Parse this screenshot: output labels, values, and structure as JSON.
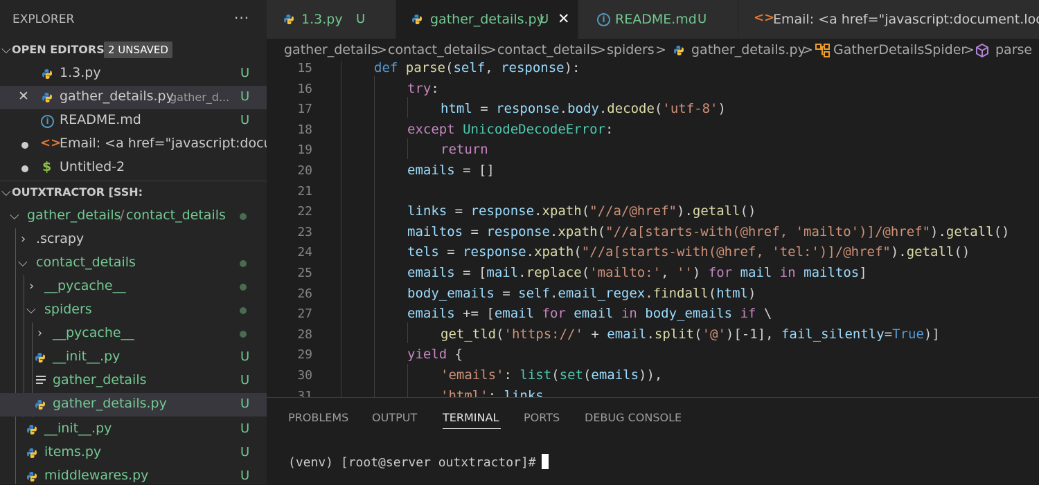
{
  "explorer": {
    "title": "EXPLORER",
    "more": "···",
    "open_editors": {
      "label": "OPEN EDITORS",
      "badge": "2 UNSAVED",
      "items": [
        {
          "name": "1.3.py",
          "status": "U"
        },
        {
          "name": "gather_details.py",
          "desc": "gather_d...",
          "status": "U"
        },
        {
          "name": "README.md",
          "status": "U"
        },
        {
          "name": "Email: <a href=\"javascript:docu..."
        },
        {
          "name": "Untitled-2"
        }
      ]
    },
    "workspace": {
      "label": "OUTXTRACTOR [SSH:",
      "tree": [
        {
          "name": "gather_details",
          "name2": "contact_details"
        },
        {
          "name": ".scrapy"
        },
        {
          "name": "contact_details"
        },
        {
          "name": "__pycache__"
        },
        {
          "name": "spiders"
        },
        {
          "name": "__pycache__"
        },
        {
          "name": "__init__.py",
          "status": "U"
        },
        {
          "name": "gather_details",
          "status": "U"
        },
        {
          "name": "gather_details.py",
          "status": "U"
        },
        {
          "name": "__init__.py",
          "status": "U"
        },
        {
          "name": "items.py",
          "status": "U"
        },
        {
          "name": "middlewares.py",
          "status": "U"
        }
      ]
    }
  },
  "tabs": [
    {
      "label": "1.3.py",
      "status": "U"
    },
    {
      "label": "gather_details.py",
      "status": "U",
      "close": "✕"
    },
    {
      "label": "README.md",
      "status": "U"
    },
    {
      "label": "Email: <a href=\"javascript:document.loca"
    }
  ],
  "breadcrumb": [
    "gather_details",
    "contact_details",
    "contact_details",
    "spiders",
    "gather_details.py",
    "GatherDetailsSpider",
    "parse"
  ],
  "editor": {
    "line_numbers": [
      "15",
      "16",
      "17",
      "18",
      "19",
      "20",
      "21",
      "22",
      "23",
      "24",
      "25",
      "26",
      "27",
      "28",
      "29",
      "30",
      "31"
    ]
  },
  "panel": {
    "tabs": [
      "PROBLEMS",
      "OUTPUT",
      "TERMINAL",
      "PORTS",
      "DEBUG CONSOLE"
    ],
    "active_tab": "TERMINAL",
    "terminal_prompt": "(venv) [root@server outxtractor]#"
  },
  "colors": {
    "accent_green": "#73c991",
    "keyword": "#569cd6",
    "string": "#ce9178",
    "function": "#dcdcaa",
    "class": "#4ec9b0"
  }
}
